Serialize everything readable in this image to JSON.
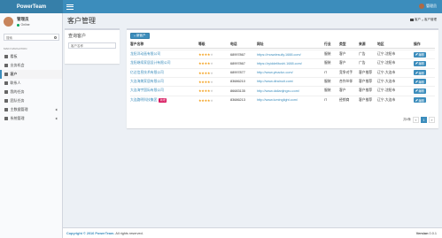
{
  "header": {
    "logo": "PowerTeam",
    "user": "管理员",
    "menu_icon": "hamburger-icon"
  },
  "sidebar": {
    "user_name": "管理员",
    "status": "Online",
    "search_placeholder": "搜索",
    "nav_header": "MAIN NAVIGATION",
    "items": [
      {
        "label": "看板",
        "icon": "dashboard-icon",
        "active": false,
        "has_children": false
      },
      {
        "label": "业务机会",
        "icon": "opportunity-icon",
        "active": false,
        "has_children": false
      },
      {
        "label": "客户",
        "icon": "customer-icon",
        "active": true,
        "has_children": false
      },
      {
        "label": "联系人",
        "icon": "contact-icon",
        "active": false,
        "has_children": false
      },
      {
        "label": "我的任务",
        "icon": "task-icon",
        "active": false,
        "has_children": false
      },
      {
        "label": "团队任务",
        "icon": "team-task-icon",
        "active": false,
        "has_children": false
      },
      {
        "label": "主数据管理",
        "icon": "master-data-icon",
        "active": false,
        "has_children": true
      },
      {
        "label": "系统管理",
        "icon": "settings-icon",
        "active": false,
        "has_children": true
      }
    ]
  },
  "content": {
    "title": "客户管理",
    "breadcrumb": [
      "客户",
      "客户管理"
    ]
  },
  "filter": {
    "title": "查询客户",
    "placeholder": "客户名称"
  },
  "table": {
    "add_label": "新客户",
    "columns": [
      "客户名称",
      "等级",
      "电话",
      "网址",
      "行业",
      "类型",
      "来源",
      "地区",
      "操作"
    ],
    "rows": [
      {
        "name": "龙阳洋动画有限公司",
        "tag": "",
        "rating": 4,
        "phone": "68997867",
        "url": "https://mowdesuily.1688.com/",
        "industry": "服装",
        "type": "客户",
        "source": "广告",
        "area": "辽宁-沈阳市",
        "action": "编辑"
      },
      {
        "name": "龙阳继续家居设计有限公司",
        "tag": "",
        "rating": 4,
        "phone": "68997867",
        "url": "https://zyiddelitushi.1688.com/",
        "industry": "服装",
        "type": "客户",
        "source": "广告",
        "area": "辽宁-沈阳市",
        "action": "编辑"
      },
      {
        "name": "亿达信息技术有限公司",
        "tag": "",
        "rating": 4,
        "phone": "68997877",
        "url": "http://www.yinadvc.com/",
        "industry": "IT",
        "type": "竞争对手",
        "source": "客户推荐",
        "area": "辽宁-大连市",
        "action": "编辑"
      },
      {
        "name": "大连海美家居有限公司",
        "tag": "",
        "rating": 4,
        "phone": "83686210",
        "url": "http://www.dlrainuit.com/",
        "industry": "服装",
        "type": "合作伙伴",
        "source": "客户推荐",
        "area": "辽宁-大连市",
        "action": "编辑"
      },
      {
        "name": "大连海宇国际有限公司",
        "tag": "",
        "rating": 4,
        "phone": "86683135",
        "url": "http://www.dalianjingxu.com/",
        "industry": "服装",
        "type": "客户",
        "source": "客户推荐",
        "area": "辽宁-沈阳市",
        "action": "编辑"
      },
      {
        "name": "大连路明科技集团",
        "tag": "新增",
        "rating": 4,
        "phone": "83686213",
        "url": "http://www.luminglight.com/",
        "industry": "IT",
        "type": "经销商",
        "source": "客户推荐",
        "area": "辽宁-大连市",
        "action": "编辑"
      }
    ]
  },
  "pagination": {
    "total": "共6条",
    "prev": "«",
    "current": "1",
    "next": "»"
  },
  "footer": {
    "copyright_prefix": "Copyright © 2016",
    "brand": "PowerTeam.",
    "rights": "All rights reserved.",
    "version_label": "Version",
    "version": "0.0.1"
  },
  "colors": {
    "primary": "#3c8dbc",
    "logo_bg": "#367fa9",
    "star": "#f39c12",
    "tag": "#d81b60",
    "online": "#00a65a"
  }
}
